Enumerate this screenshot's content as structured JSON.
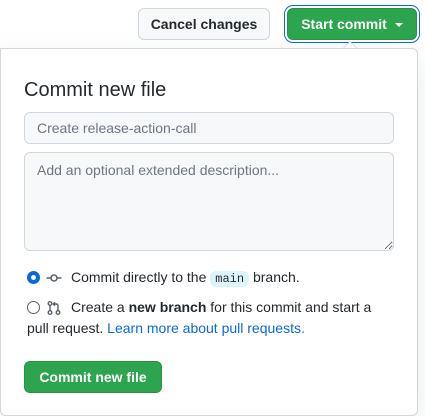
{
  "header": {
    "cancel_label": "Cancel changes",
    "start_commit_label": "Start commit"
  },
  "dialog": {
    "title": "Commit new file",
    "summary": {
      "value": "",
      "placeholder": "Create release-action-call"
    },
    "description": {
      "value": "",
      "placeholder": "Add an optional extended description..."
    },
    "options": [
      {
        "selected": true,
        "icon": "git-commit-icon",
        "text_before": "Commit directly to the",
        "branch": "main",
        "text_after": "branch."
      },
      {
        "selected": false,
        "icon": "git-pull-request-icon",
        "text_before": "Create a",
        "bold": "new branch",
        "text_after": "for this commit and start a",
        "text_line2": "pull request.",
        "link": "Learn more about pull requests."
      }
    ],
    "commit_button_label": "Commit new file"
  },
  "colors": {
    "primary_green": "#2da44e",
    "focus_blue": "#0969da",
    "branch_bg": "#ddf4ff",
    "border": "#d0d7de"
  }
}
